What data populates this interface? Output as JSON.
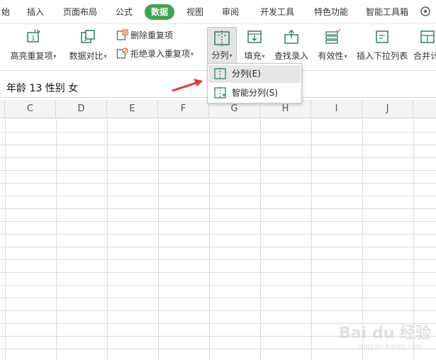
{
  "tabs": [
    "始",
    "插入",
    "页面布局",
    "公式",
    "数据",
    "视图",
    "审阅",
    "开发工具",
    "特色功能",
    "智能工具箱"
  ],
  "active_tab": "数据",
  "toolbar": {
    "highlight_dup": "高亮重复项",
    "compare": "数据对比",
    "delete_dup": "删除重复项",
    "reject_dup": "拒绝录入重复项",
    "split": "分列",
    "fill": "填充",
    "find_entry": "查找录入",
    "validity": "有效性",
    "insert_dropdown": "插入下拉列表",
    "merge": "合并计"
  },
  "cell_text": "年龄 13 性别 女",
  "columns": [
    "C",
    "D",
    "E",
    "F",
    "G",
    "H",
    "I",
    "J"
  ],
  "menu": {
    "split_item": "分列(E)",
    "smart_split_item": "智能分列(S)"
  },
  "watermark": {
    "brand": "Bai du 经验",
    "url": "jingyan.baidu.com"
  },
  "colors": {
    "accent_green": "#3fa24f",
    "arrow_red": "#e53935",
    "icon_teal": "#2e7d6b"
  }
}
